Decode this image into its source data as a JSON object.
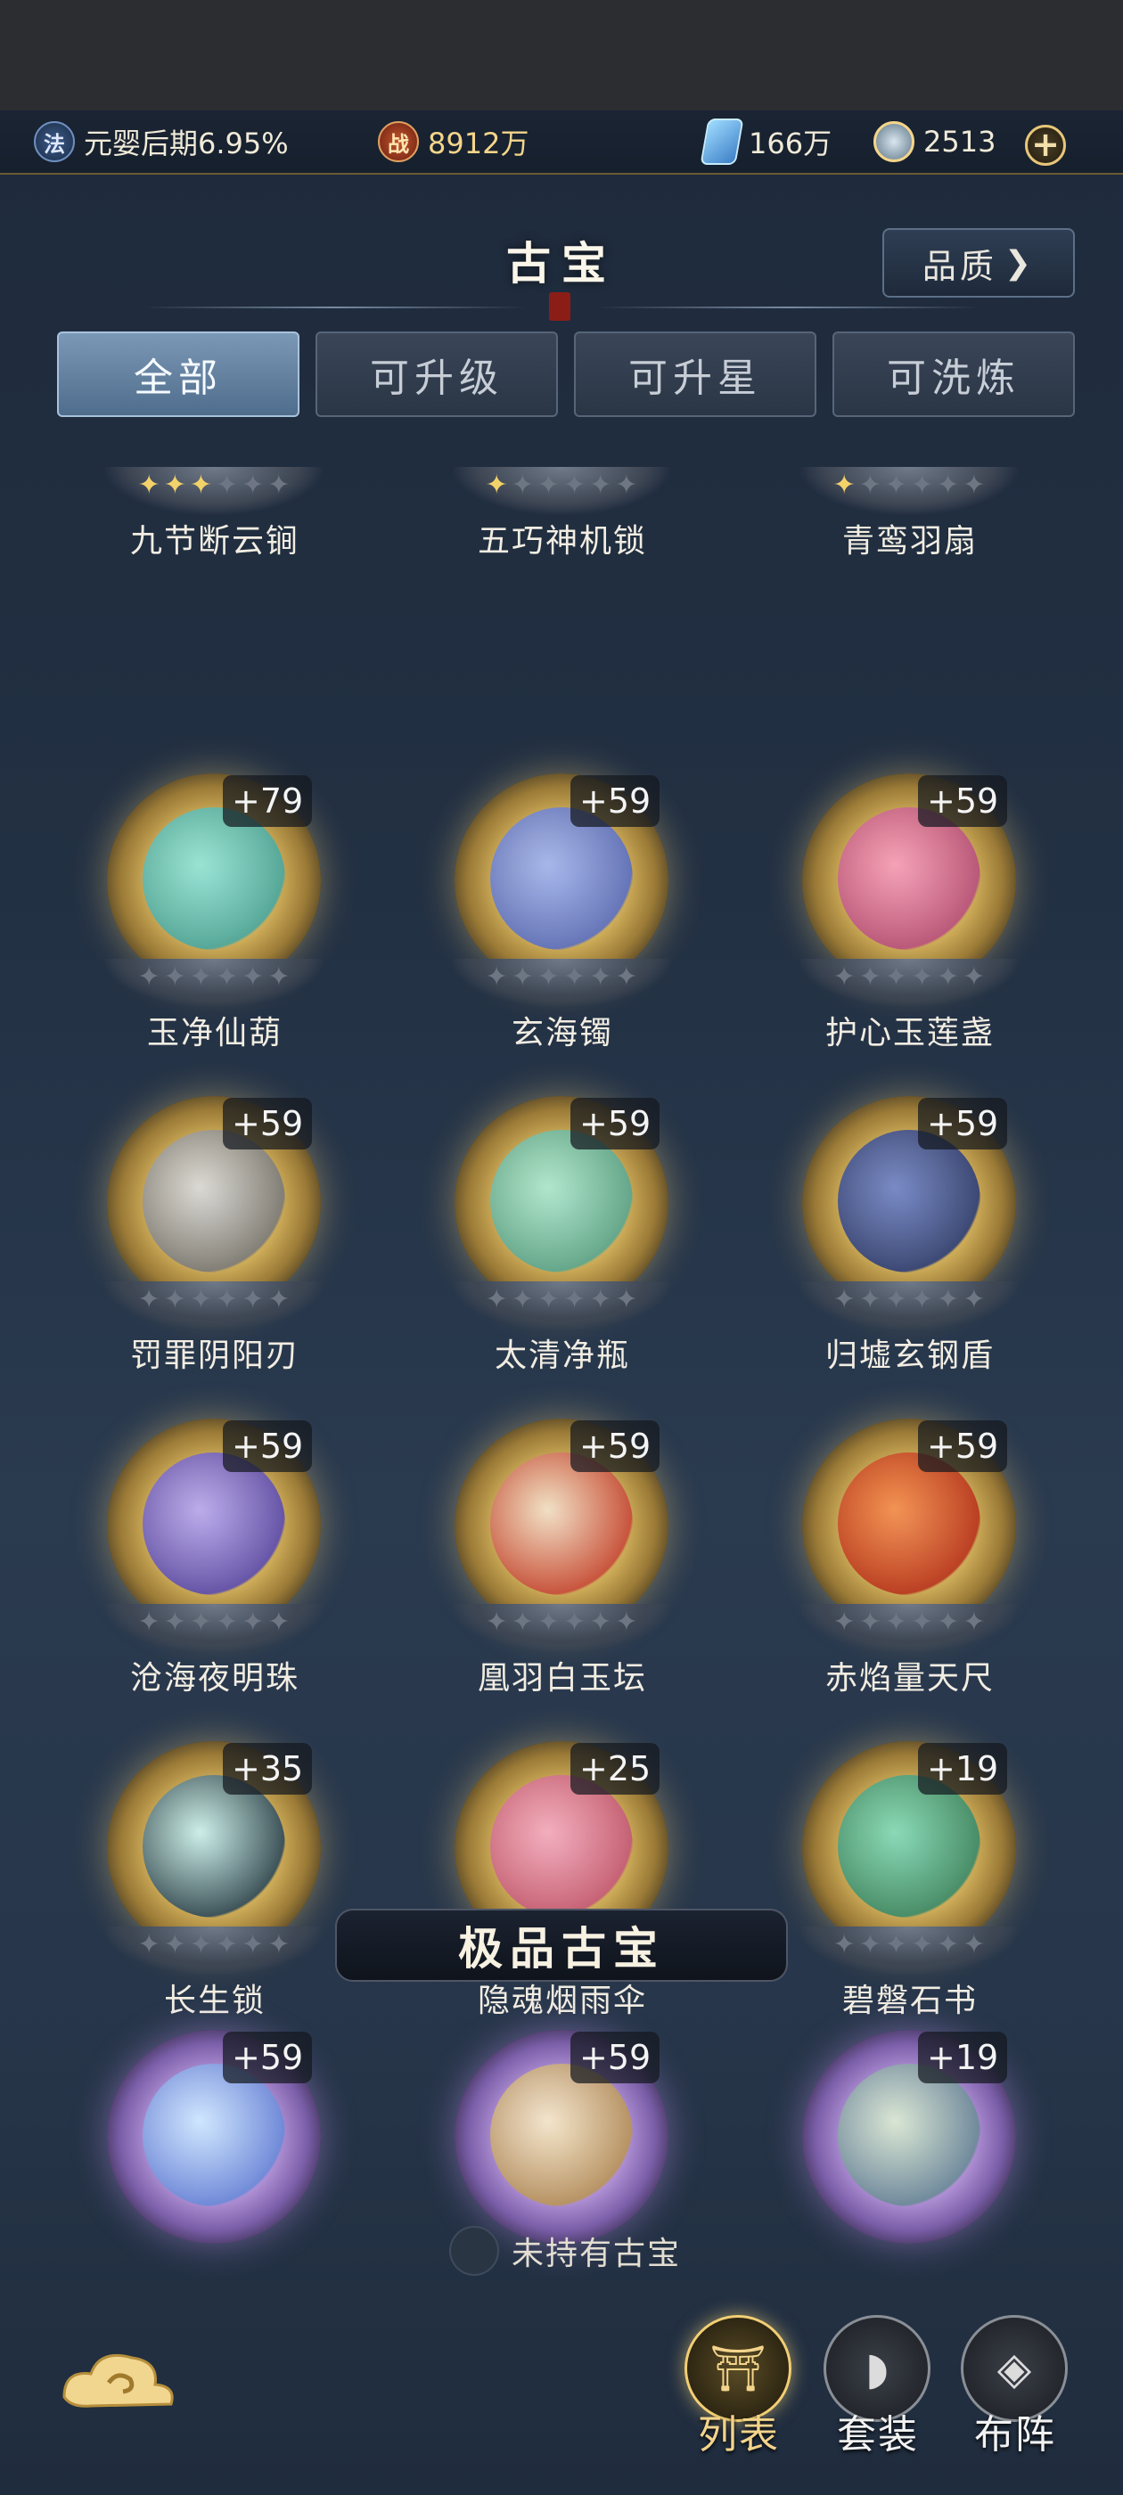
{
  "resources": {
    "realm": "元婴后期6.95%",
    "power_badge": "战",
    "power": "8912万",
    "crystal": "166万",
    "coins": "2513",
    "fa_badge": "法",
    "plus": "+"
  },
  "header": {
    "title": "古宝",
    "quality_label": "品质",
    "quality_arrow": "❯"
  },
  "tabs": [
    {
      "label": "全部",
      "active": true
    },
    {
      "label": "可升级",
      "active": false
    },
    {
      "label": "可升星",
      "active": false
    },
    {
      "label": "可洗炼",
      "active": false
    }
  ],
  "items": [
    {
      "name": "九节断云锏",
      "level": "",
      "stars": 3
    },
    {
      "name": "五巧神机锁",
      "level": "",
      "stars": 1
    },
    {
      "name": "青鸾羽扇",
      "level": "",
      "stars": 1
    },
    {
      "name": "玉净仙葫",
      "level": "+79",
      "stars": 0
    },
    {
      "name": "玄海镯",
      "level": "+59",
      "stars": 0
    },
    {
      "name": "护心玉莲盏",
      "level": "+59",
      "stars": 0
    },
    {
      "name": "罚罪阴阳刃",
      "level": "+59",
      "stars": 0
    },
    {
      "name": "太清净瓶",
      "level": "+59",
      "stars": 0
    },
    {
      "name": "归墟玄钢盾",
      "level": "+59",
      "stars": 0
    },
    {
      "name": "沧海夜明珠",
      "level": "+59",
      "stars": 0
    },
    {
      "name": "凰羽白玉坛",
      "level": "+59",
      "stars": 0
    },
    {
      "name": "赤焰量天尺",
      "level": "+59",
      "stars": 0
    },
    {
      "name": "长生锁",
      "level": "+35",
      "stars": 0
    },
    {
      "name": "隐魂烟雨伞",
      "level": "+25",
      "stars": 0
    },
    {
      "name": "碧磐石书",
      "level": "+19",
      "stars": 0
    }
  ],
  "premium_section": {
    "title": "极品古宝",
    "items": [
      {
        "level": "+59"
      },
      {
        "level": "+59"
      },
      {
        "level": "+19"
      }
    ]
  },
  "empty_note": "未持有古宝",
  "nav": [
    {
      "label": "列表",
      "icon": "cauldron-icon",
      "active": true
    },
    {
      "label": "套装",
      "icon": "fan-icon",
      "active": false
    },
    {
      "label": "布阵",
      "icon": "formation-icon",
      "active": false
    }
  ],
  "colors": {
    "accent_gold": "#f3d48b",
    "active_tab": "#6f8dab",
    "star_on": "#f3d26a"
  }
}
